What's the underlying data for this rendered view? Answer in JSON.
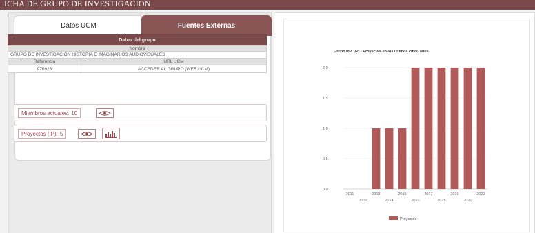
{
  "header": {
    "title": "ICHA DE GRUPO DE INVESTIGACIÓN"
  },
  "tabs": [
    {
      "label": "Datos UCM"
    },
    {
      "label": "Fuentes Externas"
    }
  ],
  "group": {
    "section_title": "Datos del grupo",
    "name_header": "Nombre",
    "name_value": "GRUPO DE INVESTIGACIÓN HISTORIA E IMAGINARIOS AUDIOVISUALES",
    "ref_header": "Referencia",
    "url_header": "URL UCM",
    "ref_value": "970923",
    "url_value": "ACCEDER AL GRUPO (WEB UCM)"
  },
  "members": {
    "label": "Miembros actuales:",
    "count": "10"
  },
  "projects": {
    "label": "Proyectos (IP):",
    "count": "5"
  },
  "icons": {
    "view": "eye-icon",
    "chart": "bar-chart-icon"
  },
  "colors": {
    "accent": "#7a4a4a",
    "bar": "#b05a5a"
  },
  "chart_data": {
    "type": "bar",
    "title": "Grupo Inv. (IP) - Proyectos en los últimos cinco años",
    "categories": [
      "2011",
      "2012",
      "2013",
      "2014",
      "2015",
      "2016",
      "2017",
      "2018",
      "2019",
      "2020",
      "2021"
    ],
    "series": [
      {
        "name": "Proyectos",
        "values": [
          0,
          0,
          1,
          1,
          1,
          2,
          2,
          2,
          2,
          2,
          2
        ]
      }
    ],
    "yticks": [
      "0.0",
      "0.5",
      "1.0",
      "1.5",
      "2.0"
    ],
    "ylim": [
      0,
      2
    ],
    "grid": true,
    "legend": "bottom"
  }
}
